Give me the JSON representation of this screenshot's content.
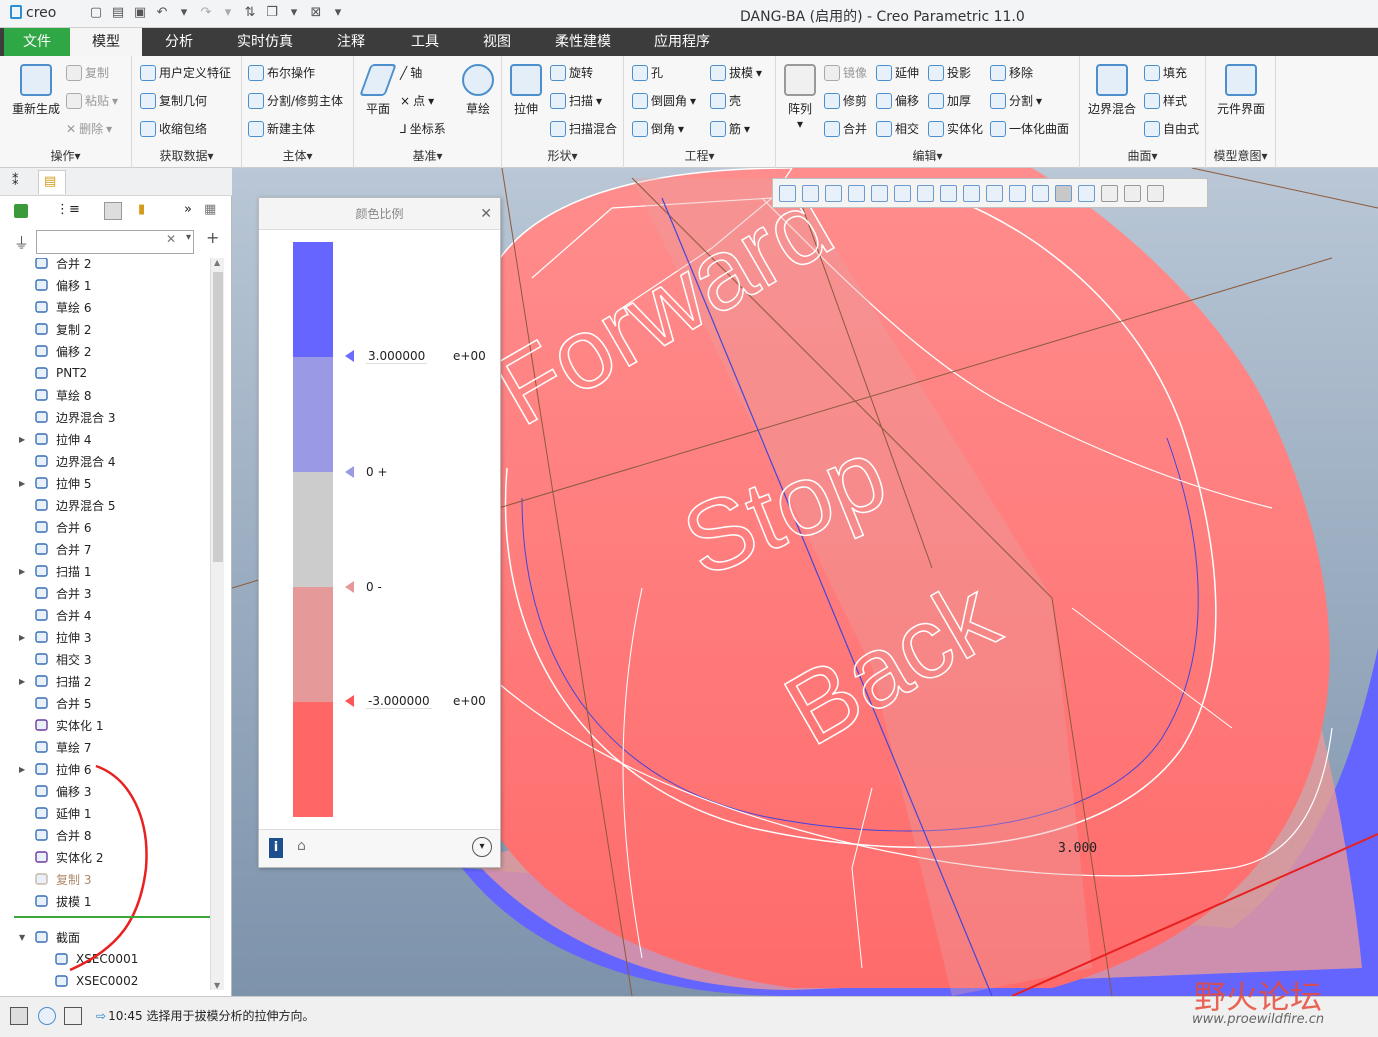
{
  "titlebar": {
    "logo": "creo",
    "title": "DANG-BA (启用的) - Creo Parametric 11.0"
  },
  "tabs": [
    "文件",
    "模型",
    "分析",
    "实时仿真",
    "注释",
    "工具",
    "视图",
    "柔性建模",
    "应用程序"
  ],
  "ribbon": {
    "operations": {
      "regen": "重新生成",
      "copy": "复制",
      "paste": "粘贴",
      "delete": "删除",
      "group": "操作"
    },
    "get_data": {
      "udf": "用户定义特征",
      "copy_geom": "复制几何",
      "shrinkwrap": "收缩包络",
      "group": "获取数据"
    },
    "body": {
      "boolean": "布尔操作",
      "split": "分割/修剪主体",
      "new_body": "新建主体",
      "group": "主体"
    },
    "datum": {
      "plane": "平面",
      "axis": "轴",
      "point": "点",
      "csys": "坐标系",
      "sketch": "草绘",
      "group": "基准"
    },
    "shapes": {
      "extrude": "拉伸",
      "revolve": "旋转",
      "sweep": "扫描",
      "swept_blend": "扫描混合",
      "group": "形状"
    },
    "engineering": {
      "hole": "孔",
      "round": "倒圆角",
      "chamfer": "倒角",
      "draft": "拔模",
      "shell": "壳",
      "rib": "筋",
      "group": "工程"
    },
    "editing": {
      "pattern": "阵列",
      "mirror": "镜像",
      "trim": "修剪",
      "merge": "合并",
      "extend": "延伸",
      "offset": "偏移",
      "intersect": "相交",
      "project": "投影",
      "thicken": "加厚",
      "solidify": "实体化",
      "remove": "移除",
      "split": "分割",
      "unify": "一体化曲面",
      "group": "编辑"
    },
    "surfaces": {
      "boundary_blend": "边界混合",
      "fill": "填充",
      "style": "样式",
      "freestyle": "自由式",
      "group": "曲面"
    },
    "model_intent": {
      "component_interface": "元件界面",
      "group": "模型意图"
    }
  },
  "tree": {
    "items": [
      {
        "label": "合并 2",
        "icon": "merge-icon",
        "expand": false
      },
      {
        "label": "偏移 1",
        "icon": "offset-icon",
        "expand": false
      },
      {
        "label": "草绘 6",
        "icon": "sketch-icon",
        "expand": false
      },
      {
        "label": "复制 2",
        "icon": "copy-icon",
        "expand": false
      },
      {
        "label": "偏移 2",
        "icon": "offset-icon",
        "expand": false
      },
      {
        "label": "PNT2",
        "icon": "point-icon",
        "expand": false
      },
      {
        "label": "草绘 8",
        "icon": "sketch-icon",
        "expand": false
      },
      {
        "label": "边界混合 3",
        "icon": "boundary-blend-icon",
        "expand": false
      },
      {
        "label": "拉伸 4",
        "icon": "extrude-icon",
        "expand": true
      },
      {
        "label": "边界混合 4",
        "icon": "boundary-blend-icon",
        "expand": false
      },
      {
        "label": "拉伸 5",
        "icon": "extrude-icon",
        "expand": true
      },
      {
        "label": "边界混合 5",
        "icon": "boundary-blend-icon",
        "expand": false
      },
      {
        "label": "合并 6",
        "icon": "merge-icon",
        "expand": false
      },
      {
        "label": "合并 7",
        "icon": "merge-icon",
        "expand": false
      },
      {
        "label": "扫描 1",
        "icon": "sweep-icon",
        "expand": true
      },
      {
        "label": "合并 3",
        "icon": "merge-icon",
        "expand": false
      },
      {
        "label": "合并 4",
        "icon": "merge-icon",
        "expand": false
      },
      {
        "label": "拉伸 3",
        "icon": "extrude-icon",
        "expand": true
      },
      {
        "label": "相交 3",
        "icon": "intersect-icon",
        "expand": false
      },
      {
        "label": "扫描 2",
        "icon": "sweep-icon",
        "expand": true
      },
      {
        "label": "合并 5",
        "icon": "merge-icon",
        "expand": false
      },
      {
        "label": "实体化 1",
        "icon": "solidify-icon",
        "expand": false
      },
      {
        "label": "草绘 7",
        "icon": "sketch-icon",
        "expand": false
      },
      {
        "label": "拉伸 6",
        "icon": "extrude-icon",
        "expand": true
      },
      {
        "label": "偏移 3",
        "icon": "offset-icon",
        "expand": false
      },
      {
        "label": "延伸 1",
        "icon": "extend-icon",
        "expand": false
      },
      {
        "label": "合并 8",
        "icon": "merge-icon",
        "expand": false
      },
      {
        "label": "实体化 2",
        "icon": "solidify-icon",
        "expand": false
      },
      {
        "label": "复制 3",
        "icon": "copy-icon",
        "expand": false,
        "dim": true
      },
      {
        "label": "拔模 1",
        "icon": "draft-icon",
        "expand": false
      }
    ],
    "sections_folder": "截面",
    "sections": [
      "XSEC0001",
      "XSEC0002"
    ]
  },
  "filter": {
    "placeholder": ""
  },
  "color_scale": {
    "title": "颜色比例",
    "max": "3.000000",
    "max_exp": "e+00",
    "zero_pos": "0 +",
    "zero_neg": "0 -",
    "min": "-3.000000",
    "min_exp": "e+00",
    "colors": [
      "#6666ff",
      "#9999e6",
      "#cccccc",
      "#e69999",
      "#ff6666"
    ]
  },
  "viewport": {
    "text_forward": "Forward",
    "text_stop": "Stop",
    "text_back": "Back",
    "dimension": "3.000"
  },
  "status": {
    "message": "10:45 选择用于拔模分析的拉伸方向。"
  },
  "watermark": {
    "title": "野火论坛",
    "url": "www.proewildfire.cn"
  }
}
